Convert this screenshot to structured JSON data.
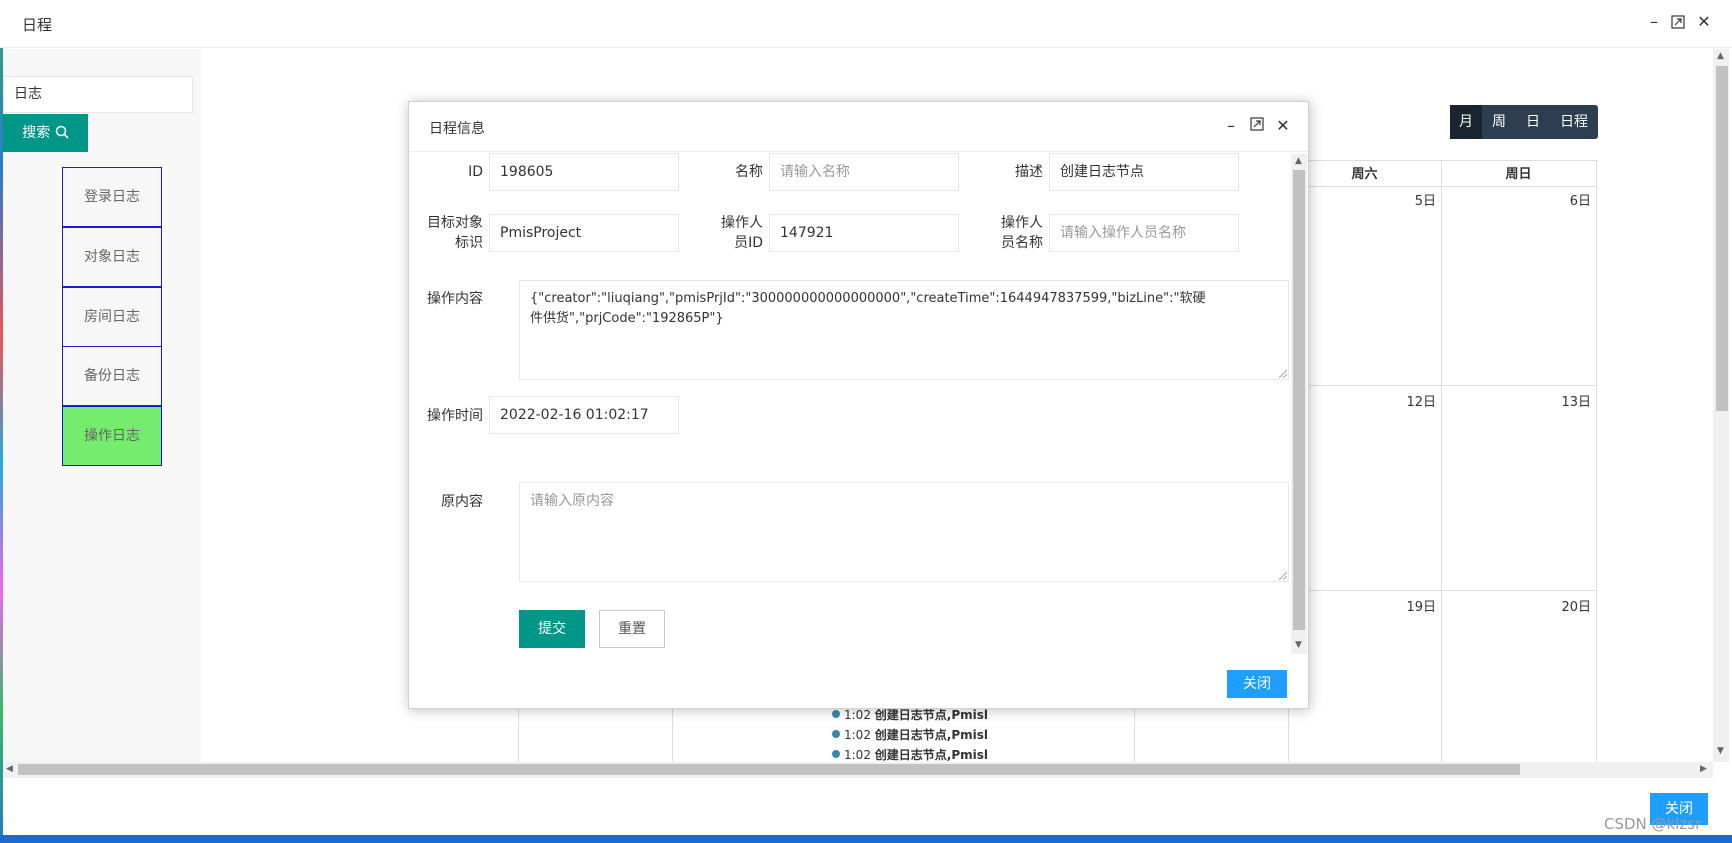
{
  "window": {
    "title": "日程"
  },
  "sidebar": {
    "search_value": "日志",
    "search_button": "搜索",
    "items": [
      {
        "label": "登录日志",
        "active": false
      },
      {
        "label": "对象日志",
        "active": false
      },
      {
        "label": "房间日志",
        "active": false
      },
      {
        "label": "备份日志",
        "active": false
      },
      {
        "label": "操作日志",
        "active": true
      }
    ]
  },
  "calendar": {
    "views": [
      "月",
      "周",
      "日",
      "日程"
    ],
    "active_view": "月",
    "weekday_headers": [
      "周六",
      "周日"
    ],
    "days": [
      "5日",
      "6日",
      "12日",
      "13日",
      "19日",
      "20日"
    ],
    "events": [
      "1:02",
      "创建日志节点,Pmisl",
      "1:02",
      "创建日志节点,Pmisl",
      "1:02",
      "创建日志节点,Pmisl"
    ]
  },
  "footer": {
    "close_label": "关闭"
  },
  "watermark": "CSDN @klzsr",
  "modal": {
    "title": "日程信息",
    "fields": {
      "id_label": "ID",
      "id_value": "198605",
      "name_label": "名称",
      "name_placeholder": "请输入名称",
      "desc_label": "描述",
      "desc_value": "创建日志节点",
      "target_label": "目标对象标识",
      "target_value": "PmisProject",
      "operator_id_label": "操作人员ID",
      "operator_id_value": "147921",
      "operator_name_label": "操作人员名称",
      "operator_name_placeholder": "请输入操作人员名称",
      "content_label": "操作内容",
      "content_value": "{\"creator\":\"liuqiang\",\"pmisPrjId\":\"300000000000000000\",\"createTime\":1644947837599,\"bizLine\":\"软硬件供货\",\"prjCode\":\"192865P\"}",
      "time_label": "操作时间",
      "time_value": "2022-02-16 01:02:17",
      "original_label": "原内容",
      "original_placeholder": "请输入原内容"
    },
    "submit_label": "提交",
    "reset_label": "重置",
    "close_label": "关闭"
  },
  "colors": {
    "primary_green": "#009688",
    "blue_button": "#1e9fff",
    "active_item": "#75ec6e",
    "item_border": "#1a1ad9",
    "view_switch_bg": "#2c3e50"
  }
}
